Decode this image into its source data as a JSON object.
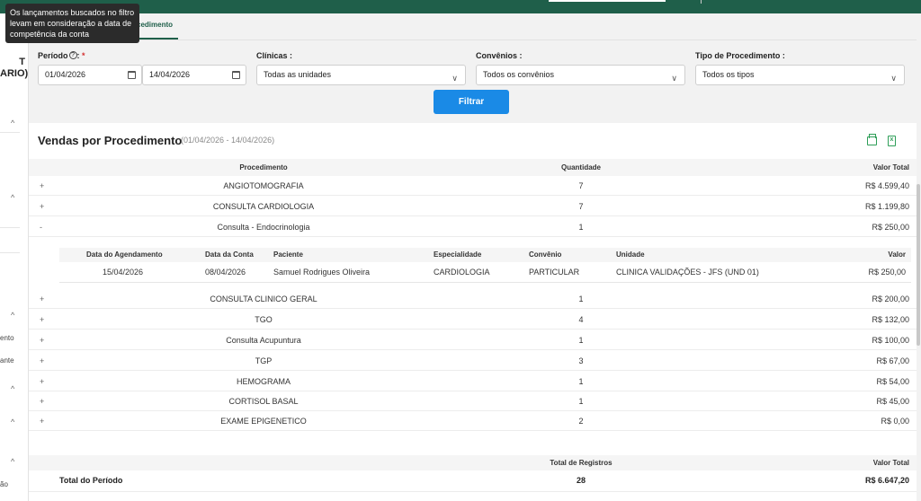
{
  "tooltip": {
    "text": "Os lançamentos buscados no filtro levam em consideração a data de competência da conta"
  },
  "tabs": {
    "active_label": "cedimento"
  },
  "sidebar": {
    "user_lines": [
      "T",
      "ARIO)"
    ],
    "items": [
      {
        "label": "ento"
      },
      {
        "label": "ante"
      },
      {
        "label": "ão"
      }
    ]
  },
  "filters": {
    "periodo_label": "Período",
    "periodo_colon": ":",
    "required_mark": "*",
    "date_start": "01/04/2026",
    "date_end": "14/04/2026",
    "clinicas_label": "Clínicas :",
    "clinicas_value": "Todas as unidades",
    "convenios_label": "Convênios :",
    "convenios_value": "Todos os convênios",
    "tipo_label": "Tipo de Procedimento :",
    "tipo_value": "Todos os tipos",
    "filter_button": "Filtrar"
  },
  "panel": {
    "title": "Vendas por Procedimento",
    "range": "(01/04/2026 - 14/04/2026)",
    "columns": {
      "procedimento": "Procedimento",
      "quantidade": "Quantidade",
      "valor_total": "Valor Total"
    },
    "rows_top": [
      {
        "toggle": "+",
        "procedimento": "ANGIOTOMOGRAFIA",
        "quantidade": "7",
        "valor": "R$ 4.599,40"
      },
      {
        "toggle": "+",
        "procedimento": "CONSULTA CARDIOLOGIA",
        "quantidade": "7",
        "valor": "R$ 1.199,80"
      },
      {
        "toggle": "-",
        "procedimento": "Consulta - Endocrinologia",
        "quantidade": "1",
        "valor": "R$ 250,00"
      }
    ],
    "detail": {
      "columns": {
        "data_agendamento": "Data do Agendamento",
        "data_conta": "Data da Conta",
        "paciente": "Paciente",
        "especialidade": "Especialidade",
        "convenio": "Convênio",
        "unidade": "Unidade",
        "valor": "Valor"
      },
      "row": {
        "data_agendamento": "15/04/2026",
        "data_conta": "08/04/2026",
        "paciente": "Samuel Rodrigues Oliveira",
        "especialidade": "CARDIOLOGIA",
        "convenio": "PARTICULAR",
        "unidade": "CLINICA VALIDAÇÕES - JFS (UND 01)",
        "valor": "R$ 250,00"
      }
    },
    "rows_bottom": [
      {
        "toggle": "+",
        "procedimento": "CONSULTA CLINICO GERAL",
        "quantidade": "1",
        "valor": "R$ 200,00"
      },
      {
        "toggle": "+",
        "procedimento": "TGO",
        "quantidade": "4",
        "valor": "R$ 132,00"
      },
      {
        "toggle": "+",
        "procedimento": "Consulta Acupuntura",
        "quantidade": "1",
        "valor": "R$ 100,00"
      },
      {
        "toggle": "+",
        "procedimento": "TGP",
        "quantidade": "3",
        "valor": "R$ 67,00"
      },
      {
        "toggle": "+",
        "procedimento": "HEMOGRAMA",
        "quantidade": "1",
        "valor": "R$ 54,00"
      },
      {
        "toggle": "+",
        "procedimento": "CORTISOL BASAL",
        "quantidade": "1",
        "valor": "R$ 45,00"
      },
      {
        "toggle": "+",
        "procedimento": "EXAME EPIGENETICO",
        "quantidade": "2",
        "valor": "R$ 0,00"
      }
    ],
    "totals": {
      "registros_label": "Total de Registros",
      "valor_label": "Valor Total",
      "periodo_label": "Total do Período",
      "registros_value": "28",
      "valor_value": "R$ 6.647,20"
    }
  }
}
